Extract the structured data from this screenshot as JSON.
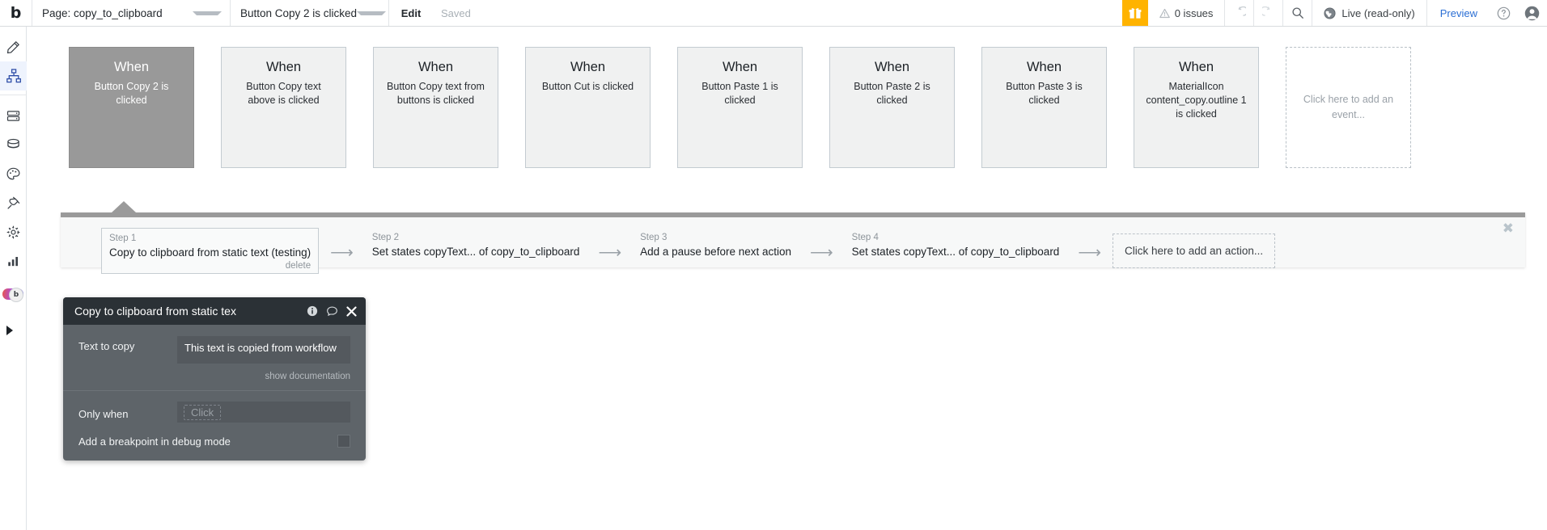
{
  "topbar": {
    "logo": "b",
    "page_selector": "Page: copy_to_clipboard",
    "event_selector": "Button Copy 2 is clicked",
    "edit_label": "Edit",
    "saved_label": "Saved",
    "gift_icon": "gift-icon",
    "issues_label": "0 issues",
    "warning_icon": "warning-triangle-icon",
    "undo_icon": "undo-icon",
    "redo_icon": "redo-icon",
    "search_icon": "search-icon",
    "globe_icon": "globe-icon",
    "version_label": "Live (read-only)",
    "preview_label": "Preview",
    "help_icon": "help-circle-icon",
    "avatar_icon": "avatar-icon",
    "accent_orange": "#ffb300",
    "link_blue": "#2a6ed4"
  },
  "rail": {
    "items": [
      {
        "icon": "pencil-design-icon",
        "name": "design"
      },
      {
        "icon": "workflow-hierarchy-icon",
        "name": "workflow",
        "active": true
      },
      {
        "icon": "data-server-icon",
        "name": "data"
      },
      {
        "icon": "database-icon",
        "name": "database"
      },
      {
        "icon": "palette-styles-icon",
        "name": "styles"
      },
      {
        "icon": "plug-plugins-icon",
        "name": "plugins"
      },
      {
        "icon": "gear-settings-icon",
        "name": "settings"
      },
      {
        "icon": "bar-chart-logs-icon",
        "name": "logs"
      }
    ],
    "toggle_name": "ai-assistant-toggle",
    "expand_name": "expand-panel-arrow"
  },
  "events": [
    {
      "when": "When",
      "desc": "Button Copy 2 is clicked",
      "selected": true
    },
    {
      "when": "When",
      "desc": "Button Copy text above is clicked",
      "selected": false
    },
    {
      "when": "When",
      "desc": "Button Copy text from buttons is clicked",
      "selected": false
    },
    {
      "when": "When",
      "desc": "Button Cut is clicked",
      "selected": false
    },
    {
      "when": "When",
      "desc": "Button Paste 1 is clicked",
      "selected": false
    },
    {
      "when": "When",
      "desc": "Button Paste 2 is clicked",
      "selected": false
    },
    {
      "when": "When",
      "desc": "Button Paste 3 is clicked",
      "selected": false
    },
    {
      "when": "When",
      "desc": "MaterialIcon content_copy.outline 1 is clicked",
      "selected": false
    }
  ],
  "add_event": {
    "label": "Click here to add an event..."
  },
  "steps": [
    {
      "num": "Step 1",
      "text": "Copy to clipboard from static text (testing)",
      "delete_label": "delete",
      "boxed": true
    },
    {
      "num": "Step 2",
      "text": "Set states copyText... of copy_to_clipboard",
      "boxed": false
    },
    {
      "num": "Step 3",
      "text": "Add a pause before next action",
      "boxed": false
    },
    {
      "num": "Step 4",
      "text": "Set states copyText... of copy_to_clipboard",
      "boxed": false
    }
  ],
  "add_action": {
    "label": "Click here to add an action..."
  },
  "panel_close": {
    "glyph": "✖"
  },
  "property_editor": {
    "title": "Copy to clipboard from static tex",
    "info_icon": "info-icon",
    "comment_icon": "comment-icon",
    "close_icon": "close-icon",
    "text_to_copy_label": "Text to copy",
    "text_to_copy_value": "This text is copied from workflow",
    "show_documentation": "show documentation",
    "only_when_label": "Only when",
    "only_when_placeholder": "Click",
    "breakpoint_label": "Add a breakpoint in debug mode",
    "breakpoint_checked": false
  }
}
